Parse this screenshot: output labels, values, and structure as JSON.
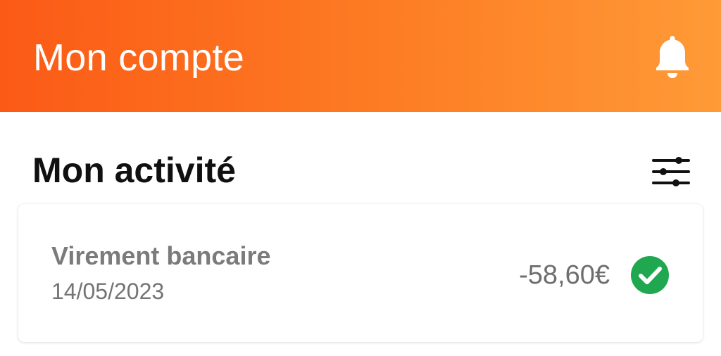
{
  "header": {
    "title": "Mon compte",
    "notification_icon": "bell-icon",
    "gradient_start": "#fb5a16",
    "gradient_end": "#ff9a37"
  },
  "activity": {
    "title": "Mon activité",
    "filter_icon": "sliders-icon",
    "transactions": [
      {
        "label": "Virement bancaire",
        "date": "14/05/2023",
        "amount": "-58,60€",
        "status_icon": "check-circle-icon",
        "status_color": "#1fa84f"
      }
    ]
  }
}
